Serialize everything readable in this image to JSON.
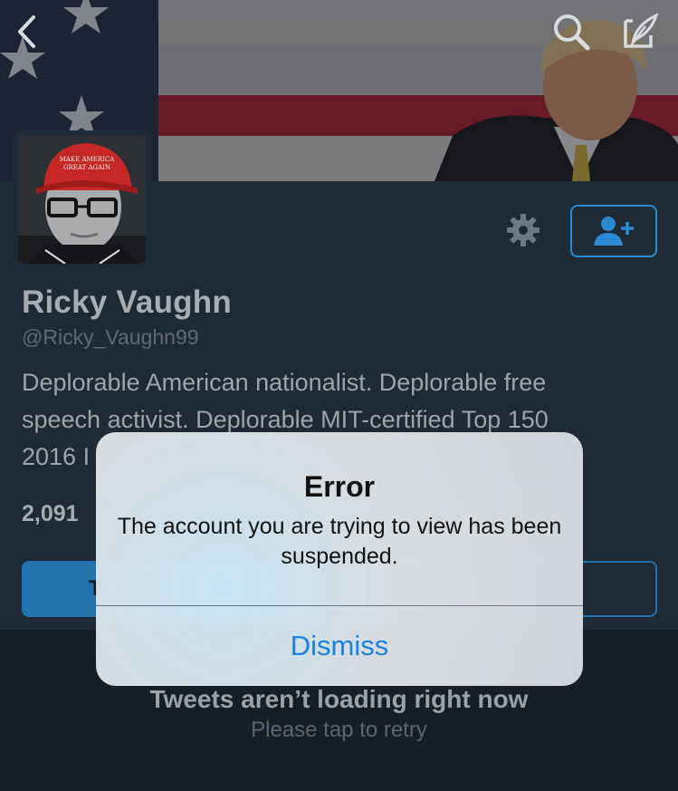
{
  "nav": {
    "back_icon": "chevron-left-icon",
    "search_icon": "search-icon",
    "compose_icon": "compose-tweet-icon"
  },
  "profile": {
    "name": "Ricky Vaughn",
    "handle": "@Ricky_Vaughn99",
    "bio_line1": "Deplorable American nationalist. Deplorable free",
    "bio_line2": "speech activist. Deplorable MIT-certified Top 150",
    "bio_line3": "2016 I",
    "stat_count": "2,091",
    "settings_icon": "gear-icon",
    "follow_icon": "add-user-icon"
  },
  "tabs": {
    "left_label_partial": "T"
  },
  "timeline": {
    "error_title": "Tweets aren’t loading right now",
    "retry_text": "Please tap to retry"
  },
  "alert": {
    "title": "Error",
    "message": "The account you are trying to view has been suspended.",
    "dismiss_label": "Dismiss"
  },
  "colors": {
    "accent": "#1a7fe0",
    "profile_bg": "#1e2a36",
    "button_blue": "#2472ad"
  }
}
